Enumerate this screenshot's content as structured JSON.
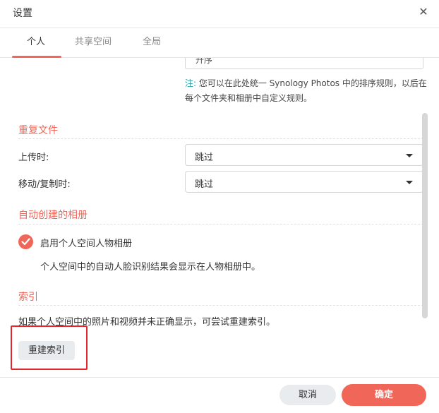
{
  "window": {
    "title": "设置",
    "close_icon": "close-icon"
  },
  "tabs": [
    {
      "label": "个人",
      "active": true
    },
    {
      "label": "共享空间",
      "active": false
    },
    {
      "label": "全局",
      "active": false
    }
  ],
  "top_select": {
    "partial_value": "升序"
  },
  "note": {
    "prefix": "注:",
    "text": "您可以在此处统一 Synology Photos 中的排序规则，以后在每个文件夹和相册中自定义规则。"
  },
  "duplicates": {
    "title": "重复文件",
    "upload_label": "上传时:",
    "upload_value": "跳过",
    "move_label": "移动/复制时:",
    "move_value": "跳过"
  },
  "auto_album": {
    "title": "自动创建的相册",
    "checkbox_label": "启用个人空间人物相册",
    "checked": true,
    "description": "个人空间中的自动人脸识别结果会显示在人物相册中。"
  },
  "index": {
    "title": "索引",
    "description": "如果个人空间中的照片和视频并未正确显示，可尝试重建索引。",
    "rebuild_label": "重建索引"
  },
  "footer": {
    "cancel_label": "取消",
    "ok_label": "确定"
  },
  "colors": {
    "accent": "#f0675a",
    "note_prefix": "#1ba6a6",
    "highlight": "#e3262d"
  }
}
